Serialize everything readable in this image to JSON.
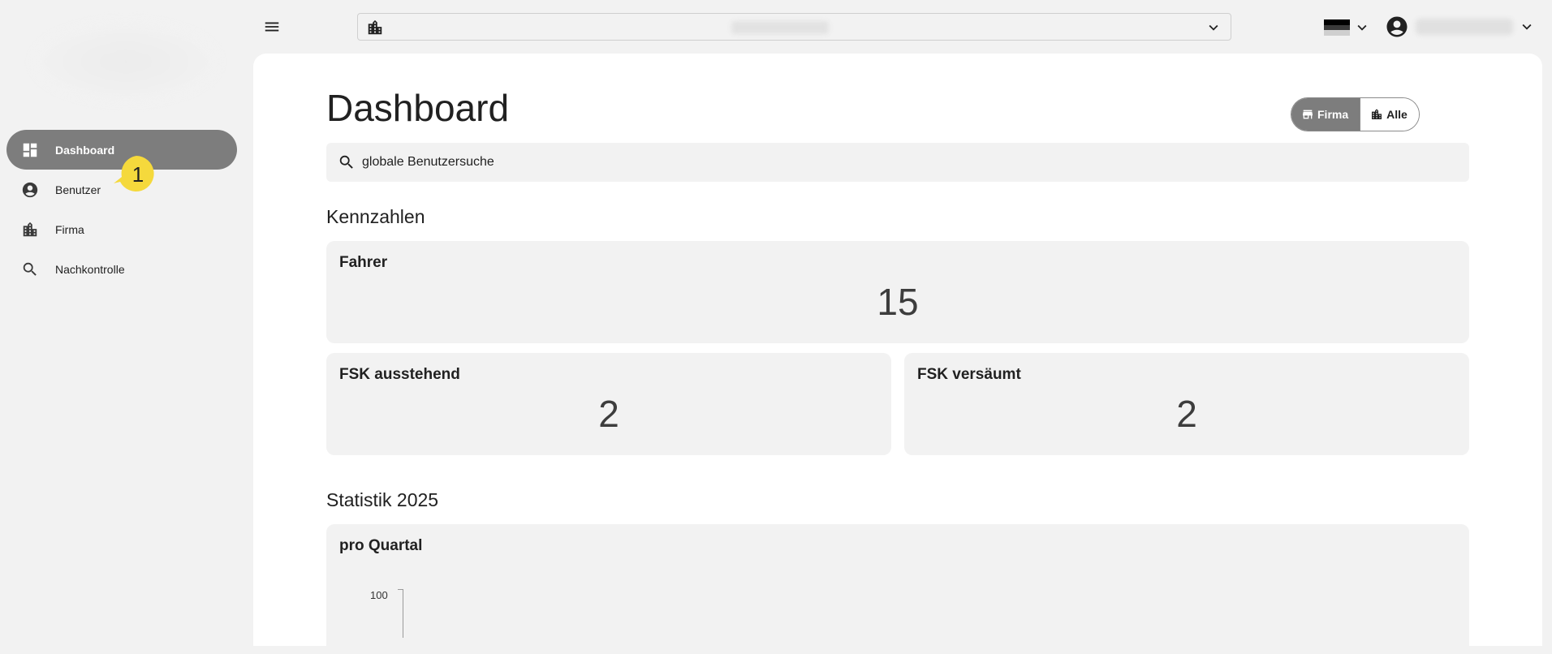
{
  "sidebar": {
    "items": [
      {
        "label": "Dashboard",
        "icon": "dashboard-icon",
        "active": true
      },
      {
        "label": "Benutzer",
        "icon": "account-circle-icon"
      },
      {
        "label": "Firma",
        "icon": "building-icon"
      },
      {
        "label": "Nachkontrolle",
        "icon": "search-icon"
      }
    ],
    "callout_badge": "1"
  },
  "topbar": {
    "menu_icon": "hamburger-menu-icon",
    "tenant_icon": "building-icon",
    "language_flag": "germany-flag",
    "flag_colors": [
      "#000000",
      "#dd0000",
      "#ffce00"
    ]
  },
  "page": {
    "title": "Dashboard",
    "toggle": {
      "firma": "Firma",
      "alle": "Alle"
    },
    "search": {
      "value": "globale Benutzersuche"
    }
  },
  "kennzahlen": {
    "title": "Kennzahlen",
    "cards": [
      {
        "label": "Fahrer",
        "value": "15"
      },
      {
        "label": "FSK ausstehend",
        "value": "2"
      },
      {
        "label": "FSK versäumt",
        "value": "2"
      }
    ]
  },
  "statistik": {
    "title": "Statistik 2025",
    "card_title": "pro Quartal",
    "y_tick": "100"
  },
  "colors": {
    "active_nav": "#7d7d7d",
    "badge": "#f5d93c",
    "background": "#f2f2f2"
  }
}
